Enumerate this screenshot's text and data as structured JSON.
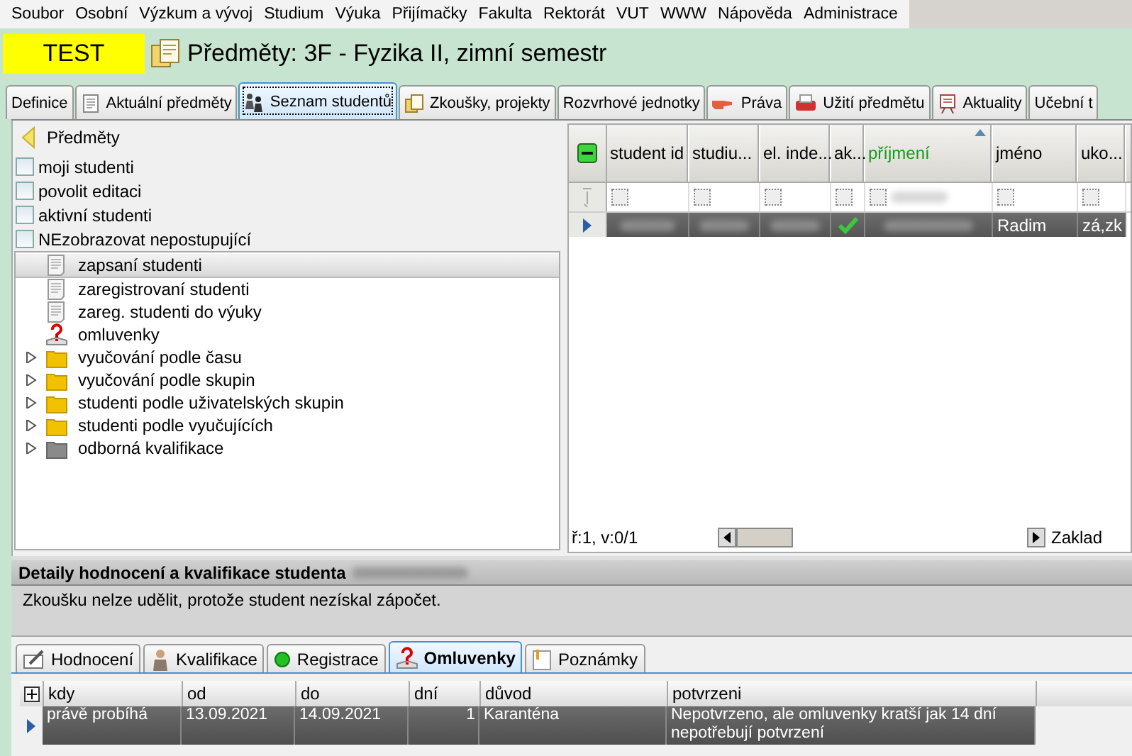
{
  "menu": [
    "Soubor",
    "Osobní",
    "Výzkum a vývoj",
    "Studium",
    "Výuka",
    "Přijímačky",
    "Fakulta",
    "Rektorát",
    "VUT",
    "WWW",
    "Nápověda",
    "Administrace"
  ],
  "badge": "TEST",
  "title": "Předměty: 3F - Fyzika II, zimní semestr",
  "tabs": [
    {
      "label": "Definice",
      "selected": false
    },
    {
      "label": "Aktuální předměty",
      "selected": false
    },
    {
      "label": "Seznam studentů",
      "selected": true
    },
    {
      "label": "Zkoušky, projekty",
      "selected": false
    },
    {
      "label": "Rozvrhové jednotky",
      "selected": false
    },
    {
      "label": "Práva",
      "selected": false
    },
    {
      "label": "Užití předmětu",
      "selected": false
    },
    {
      "label": "Aktuality",
      "selected": false
    },
    {
      "label": "Učební t",
      "selected": false
    }
  ],
  "back_link": "Předměty",
  "filters": [
    {
      "label": "moji studenti",
      "checked": false
    },
    {
      "label": "povolit editaci",
      "checked": false
    },
    {
      "label": "aktivní studenti",
      "checked": false
    },
    {
      "label": "NEzobrazovat nepostupující",
      "checked": false
    }
  ],
  "tree": [
    {
      "label": "zapsaní studenti",
      "kind": "page",
      "selected": true
    },
    {
      "label": "zaregistrovaní studenti",
      "kind": "page",
      "selected": false
    },
    {
      "label": "zareg. studenti do výuky",
      "kind": "page",
      "selected": false
    },
    {
      "label": "omluvenky",
      "kind": "excuse",
      "selected": false
    },
    {
      "label": "vyučování podle času",
      "kind": "folder",
      "selected": false,
      "expanded": false
    },
    {
      "label": "vyučování podle skupin",
      "kind": "folder",
      "selected": false,
      "expanded": false
    },
    {
      "label": "studenti podle uživatelských skupin",
      "kind": "folder",
      "selected": false,
      "expanded": false
    },
    {
      "label": "studenti podle vyučujících",
      "kind": "folder",
      "selected": false,
      "expanded": false
    },
    {
      "label": "odborná kvalifikace",
      "kind": "folder_gray",
      "selected": false,
      "expanded": false
    }
  ],
  "students": {
    "columns": [
      {
        "label": "student id",
        "sorted": false
      },
      {
        "label": "studiu...",
        "sorted": false
      },
      {
        "label": "el. inde...",
        "sorted": false
      },
      {
        "label": "ak...",
        "sorted": false
      },
      {
        "label": "příjmení",
        "sorted": true
      },
      {
        "label": "jméno",
        "sorted": false
      },
      {
        "label": "uko...",
        "sorted": false
      }
    ],
    "filter_row": [
      {
        "kind": "empty"
      },
      {
        "kind": "empty"
      },
      {
        "kind": "empty"
      },
      {
        "kind": "empty"
      },
      {
        "kind": "blurred_filter"
      },
      {
        "kind": "empty"
      },
      {
        "kind": "empty"
      }
    ],
    "rows": [
      {
        "selected": true,
        "cells": [
          {
            "kind": "blurred"
          },
          {
            "kind": "blurred"
          },
          {
            "kind": "blurred"
          },
          {
            "kind": "check",
            "checked": true
          },
          {
            "kind": "blurred"
          },
          {
            "kind": "text",
            "text": "Radim"
          },
          {
            "kind": "text",
            "text": "zá,zk"
          }
        ]
      }
    ],
    "status": "ř:1, v:0/1",
    "layout": "Zaklad"
  },
  "detail": {
    "title": "Detaily hodnocení a kvalifikace studenta",
    "message": "Zkoušku nelze udělit, protože student nezískal zápočet.",
    "tabs": [
      {
        "label": "Hodnocení",
        "selected": false
      },
      {
        "label": "Kvalifikace",
        "selected": false
      },
      {
        "label": "Registrace",
        "selected": false
      },
      {
        "label": "Omluvenky",
        "selected": true
      },
      {
        "label": "Poznámky",
        "selected": false
      }
    ],
    "columns": [
      "kdy",
      "od",
      "do",
      "dní",
      "důvod",
      "potvrzeni"
    ],
    "rows": [
      {
        "selected": true,
        "cells": [
          "právě probíhá",
          "13.09.2021",
          "14.09.2021",
          "1",
          "Karanténa",
          "Nepotvrzeno, ale omluvenky kratší jak 14 dní nepotřebují potvrzení"
        ]
      }
    ]
  }
}
